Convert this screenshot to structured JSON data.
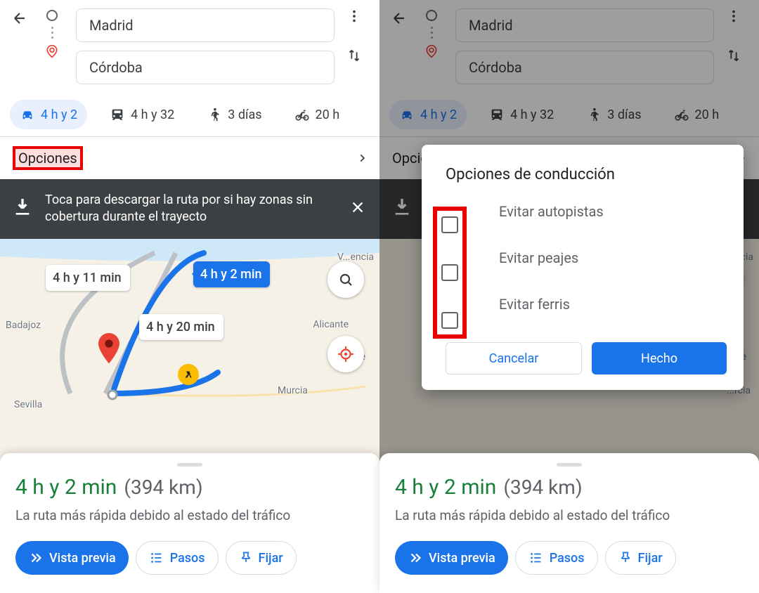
{
  "header": {
    "origin": "Madrid",
    "destination": "Córdoba"
  },
  "modes": {
    "car": "4 h y 2",
    "transit": "4 h y 32",
    "walk": "3 días",
    "bike": "20 h"
  },
  "options_row": {
    "label": "Opciones"
  },
  "download_banner": {
    "message": "Toca para descargar la ruta por si hay zonas sin cobertura durante el trayecto"
  },
  "map": {
    "routes": {
      "alt1": "4 h y 11 min",
      "main": "4 h y 2 min",
      "alt2": "4 h y 20 min"
    },
    "labels": {
      "badajoz": "Badajoz",
      "sevilla": "Sevilla",
      "murcia": "Murcia",
      "valencia": "V...encia",
      "alicante": "Alicante",
      "elche": "Elche"
    }
  },
  "sheet": {
    "time": "4 h y 2 min",
    "distance": "(394 km)",
    "subtitle": "La ruta más rápida debido al estado del tráfico",
    "buttons": {
      "preview": "Vista previa",
      "steps": "Pasos",
      "pin": "Fijar"
    }
  },
  "dialog": {
    "title": "Opciones de conducción",
    "opts": {
      "highways": "Evitar autopistas",
      "tolls": "Evitar peajes",
      "ferries": "Evitar ferris"
    },
    "cancel": "Cancelar",
    "done": "Hecho"
  }
}
